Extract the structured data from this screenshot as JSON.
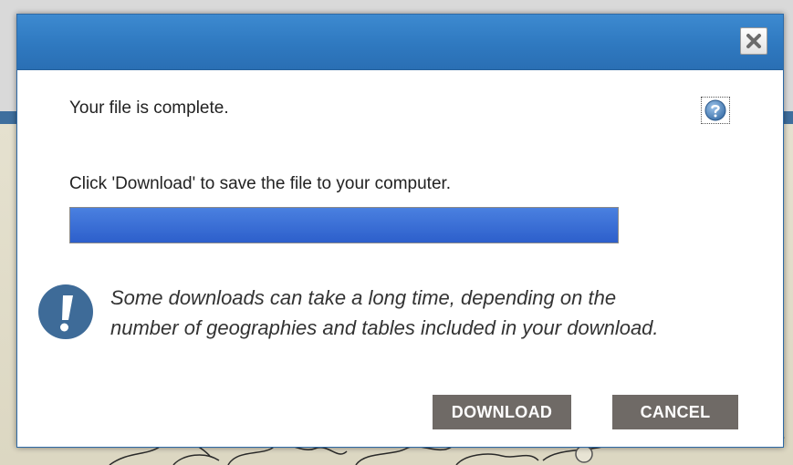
{
  "dialog": {
    "close_icon": "close-x-icon",
    "help_icon": "question-mark-icon",
    "status_message": "Your file is complete.",
    "instruction": "Click 'Download' to save the file to your computer.",
    "progress_percent": 100,
    "info_icon": "exclamation-icon",
    "info_text": "Some downloads can take a long time, depending on the number of geographies and tables included in your download.",
    "download_label": "DOWNLOAD",
    "cancel_label": "CANCEL"
  },
  "colors": {
    "titlebar": "#2f79c0",
    "progress_fill": "#2d5fcb",
    "button": "#6f6a66",
    "info_icon": "#3e6b98"
  }
}
